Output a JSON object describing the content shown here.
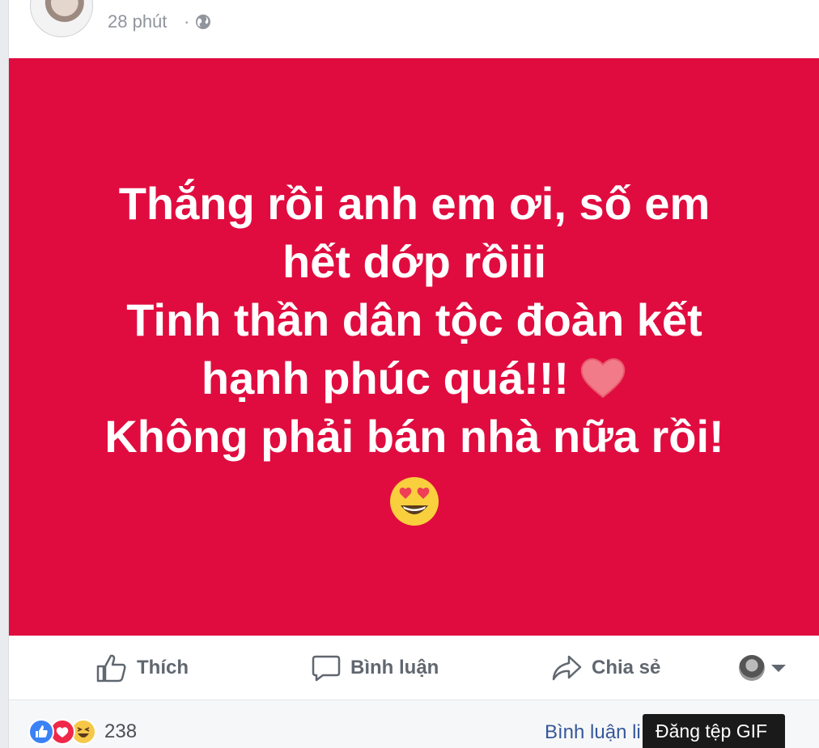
{
  "post": {
    "time": "28 phút",
    "separator": "·",
    "lines": [
      "Thắng rồi anh em ơi, số em",
      "hết dớp rồiii",
      "Tinh thần dân tộc đoàn kết",
      "hạnh phúc quá!!!",
      "Không phải bán nhà nữa rồi!"
    ],
    "banner_color": "#e00c3f"
  },
  "actions": {
    "like_label": "Thích",
    "comment_label": "Bình luận",
    "share_label": "Chia sẻ"
  },
  "footer": {
    "reaction_count": "238",
    "comments_link": "Bình luận li"
  },
  "tooltip": {
    "text": "Đăng tệp GIF"
  }
}
